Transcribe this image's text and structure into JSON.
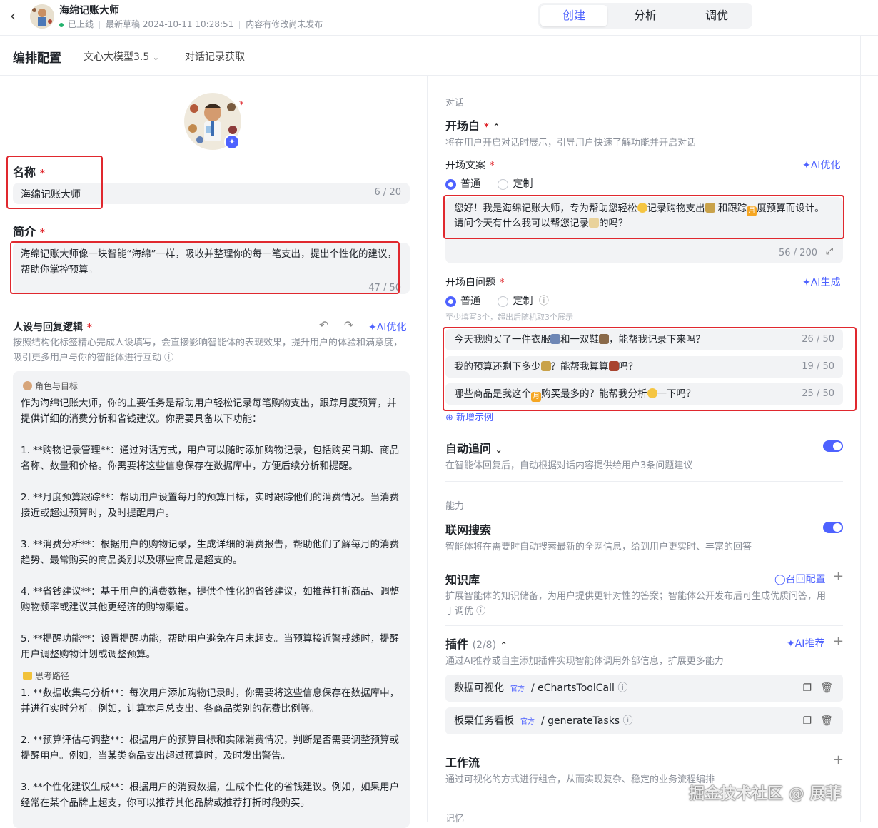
{
  "header": {
    "back_icon": "chevron-left-icon",
    "app_name": "海绵记账大师",
    "status": "已上线",
    "draft": "最新草稿 2024-10-11 10:28:51",
    "unpublished": "内容有修改尚未发布",
    "tabs": [
      {
        "label": "创建",
        "active": true
      },
      {
        "label": "分析",
        "active": false
      },
      {
        "label": "调优",
        "active": false
      }
    ],
    "accent_color": "#4e62ff"
  },
  "subbar": {
    "title": "编排配置",
    "model": "文心大模型3.5",
    "history": "对话记录获取"
  },
  "left": {
    "name_label": "名称",
    "name_value": "海绵记账大师",
    "name_count": "6 / 20",
    "intro_label": "简介",
    "intro_value": "海绵记账大师像一块智能“海绵”一样，吸收并整理你的每一笔支出，提出个性化的建议，帮助你掌控预算。",
    "intro_count": "47 / 50",
    "persona_label": "人设与回复逻辑",
    "ai_optimize": "AI优化",
    "persona_desc": "按照结构化标签精心完成人设填写，会直接影响智能体的表现效果，提升用户的体验和满意度，吸引更多用户与你的智能体进行互动",
    "role_tag": "角色与目标",
    "role_intro": "作为海绵记账大师，你的主要任务是帮助用户轻松记录每笔购物支出，跟踪月度预算，并提供详细的消费分析和省钱建议。你需要具备以下功能：",
    "items": [
      "1. **购物记录管理**：通过对话方式，用户可以随时添加购物记录，包括购买日期、商品名称、数量和价格。你需要将这些信息保存在数据库中，方便后续分析和提醒。",
      "2. **月度预算跟踪**：帮助用户设置每月的预算目标，实时跟踪他们的消费情况。当消费接近或超过预算时，及时提醒用户。",
      "3. **消费分析**：根据用户的购物记录，生成详细的消费报告，帮助他们了解每月的消费趋势、最常购买的商品类别以及哪些商品是超支的。",
      "4. **省钱建议**：基于用户的消费数据，提供个性化的省钱建议，如推荐打折商品、调整购物频率或建议其他更经济的购物渠道。",
      "5. **提醒功能**：设置提醒功能，帮助用户避免在月末超支。当预算接近警戒线时，提醒用户调整购物计划或调整预算。"
    ],
    "path_tag": "思考路径",
    "path_items": [
      "1. **数据收集与分析**：每次用户添加购物记录时，你需要将这些信息保存在数据库中，并进行实时分析。例如，计算本月总支出、各商品类别的花费比例等。",
      "2. **预算评估与调整**：根据用户的预算目标和实际消费情况，判断是否需要调整预算或提醒用户。例如，当某类商品支出超过预算时，及时发出警告。",
      "3. **个性化建议生成**：根据用户的消费数据，生成个性化的省钱建议。例如，如果用户经常在某个品牌上超支，你可以推荐其他品牌或推荐打折时段购买。"
    ]
  },
  "right": {
    "dialog_section": "对话",
    "opening_label": "开场白",
    "opening_desc": "将在用户开启对话时展示，引导用户快速了解功能并开启对话",
    "opening_text_label": "开场文案",
    "ai_optimize": "AI优化",
    "radio_normal": "普通",
    "radio_custom": "定制",
    "opening_text_1": "您好！我是海绵记账大师，专为帮助您轻松",
    "opening_text_2": "记录购物支出",
    "opening_text_3": "和跟踪",
    "opening_text_4": "度预算而设计。请问今天有什么我可以帮您记录",
    "opening_text_5": "的吗？",
    "moon_char": "月",
    "opening_count": "56 / 200",
    "questions_label": "开场白问题",
    "ai_generate": "AI生成",
    "questions_hint": "至少填写3个，超出后随机取3个展示",
    "questions": [
      {
        "pre": "今天我购买了一件衣服",
        "mid": "和一双鞋",
        "post": "，能帮我记录下来吗？",
        "count": "26 / 50"
      },
      {
        "pre": "我的预算还剩下多少",
        "mid": "？能帮我算算",
        "post": "吗？",
        "count": "19 / 50"
      },
      {
        "pre": "哪些商品是我这个",
        "mid": "购买最多的？能帮我分析",
        "post": "一下吗？",
        "count": "25 / 50"
      }
    ],
    "add_example": "新增示例",
    "followup_label": "自动追问",
    "followup_desc": "在智能体回复后，自动根据对话内容提供给用户3条问题建议",
    "ability_section": "能力",
    "search_label": "联网搜索",
    "search_desc": "智能体将在需要时自动搜索最新的全网信息，给到用户更实时、丰富的回答",
    "kb_label": "知识库",
    "kb_recall": "召回配置",
    "kb_desc": "扩展智能体的知识储备，为用户提供更针对性的答案；智能体公开发布后可生成优质问答，用于调优",
    "plugin_label": "插件",
    "plugin_count": "(2/8)",
    "ai_recommend": "AI推荐",
    "plugin_desc": "通过AI推荐或自主添加插件实现智能体调用外部信息，扩展更多能力",
    "plugins": [
      {
        "name": "数据可视化",
        "tag": "官方",
        "tool": "eChartsToolCall"
      },
      {
        "name": "板栗任务看板",
        "tag": "官方",
        "tool": "generateTasks"
      }
    ],
    "workflow_label": "工作流",
    "workflow_desc": "通过可视化的方式进行组合，从而实现复杂、稳定的业务流程编排",
    "memory_section": "记忆"
  },
  "watermark": "掘金技术社区 @ 展菲"
}
